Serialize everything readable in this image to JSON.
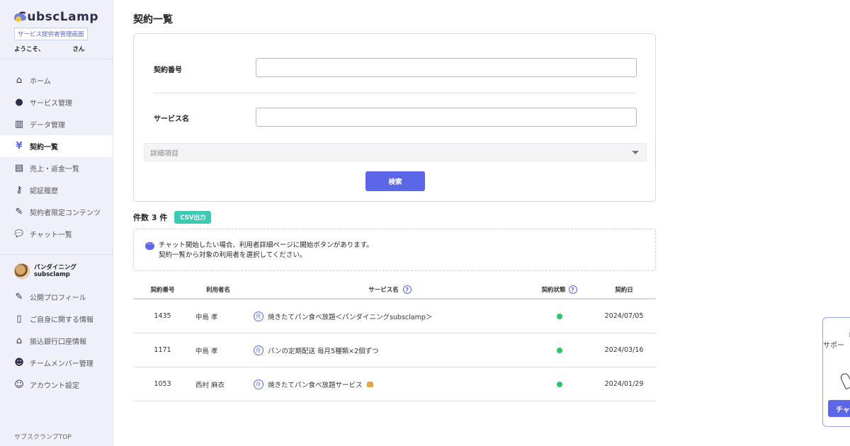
{
  "brand": {
    "logo_text": "SubscLamp",
    "tagline": "サービス提供者管理画面",
    "welcome_prefix": "ようこそ、",
    "welcome_suffix": "さん"
  },
  "nav": [
    {
      "label": "ホーム",
      "icon": "home-icon",
      "glyph": "⌂"
    },
    {
      "label": "サービス管理",
      "icon": "services-icon",
      "glyph": "●"
    },
    {
      "label": "データ管理",
      "icon": "chart-icon",
      "glyph": "▥"
    },
    {
      "label": "契約一覧",
      "icon": "yen-icon",
      "glyph": "¥",
      "active": true
    },
    {
      "label": "売上・返金一覧",
      "icon": "document-icon",
      "glyph": "▤"
    },
    {
      "label": "認証履歴",
      "icon": "key-icon",
      "glyph": "⚷"
    },
    {
      "label": "契約者限定コンテンツ",
      "icon": "edit-icon",
      "glyph": "✎"
    },
    {
      "label": "チャット一覧",
      "icon": "chat-icon",
      "glyph": "💬"
    }
  ],
  "account": {
    "name": "パンダイニング",
    "id": "subsclamp",
    "items": [
      {
        "label": "公開プロフィール",
        "icon": "pencil-icon",
        "glyph": "✎"
      },
      {
        "label": "ご自身に関する情報",
        "icon": "profile-icon",
        "glyph": "▯"
      },
      {
        "label": "振込銀行口座情報",
        "icon": "bank-icon",
        "glyph": "⌂"
      },
      {
        "label": "チームメンバー管理",
        "icon": "team-icon",
        "glyph": "☻"
      },
      {
        "label": "アカウント設定",
        "icon": "user-icon",
        "glyph": "☺"
      }
    ]
  },
  "sidebar_footer": "サブスクランプTOP",
  "page": {
    "title": "契約一覧"
  },
  "search": {
    "contract_number_label": "契約番号",
    "contract_number_value": "",
    "service_name_label": "サービス名",
    "service_name_value": "",
    "details_label": "詳細項目",
    "submit_label": "検索"
  },
  "results": {
    "count_label": "件数 3 件",
    "csv_label": "CSV出力"
  },
  "notice": {
    "line1": "チャット開始したい場合、利用者詳細ページに開始ボタンがあります。",
    "line2": "契約一覧から対象の利用者を選択してください。"
  },
  "table": {
    "headers": {
      "number": "契約番号",
      "user": "利用者名",
      "service": "サービス名",
      "status": "契約状態",
      "date": "契約日"
    },
    "rows": [
      {
        "number": "1435",
        "user": "中島 孝",
        "service": "焼きたてパン食べ放題＜パンダイニングsubsclamp＞",
        "date": "2024/07/05"
      },
      {
        "number": "1171",
        "user": "中島 孝",
        "service": "パンの定期配送 毎月5種類×2個ずつ",
        "date": "2024/03/16"
      },
      {
        "number": "1053",
        "user": "西村 麻衣",
        "service": "焼きたてパン食べ放題サービス",
        "date": "2024/01/29"
      }
    ],
    "status_color": "#2ec46e"
  },
  "chat_widget": {
    "line1": "専属",
    "line2": "サポー",
    "button_label": "チャ"
  },
  "colors": {
    "accent": "#5b67e6",
    "csv": "#3ec9b4",
    "sidebar_bg": "#f0f0fa"
  }
}
